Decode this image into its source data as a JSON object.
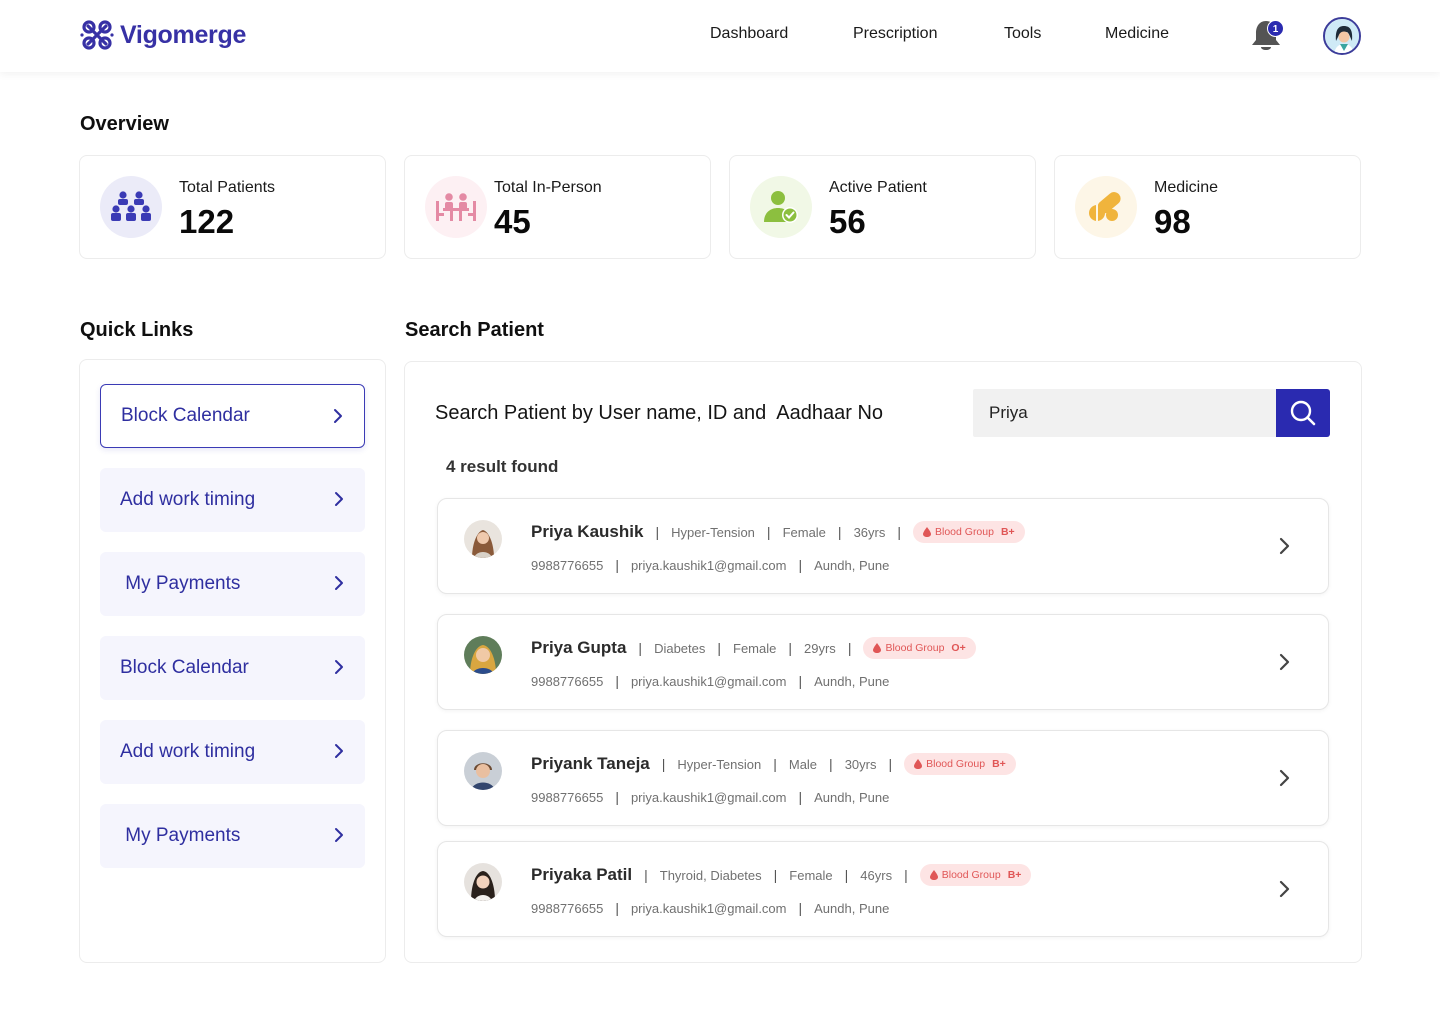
{
  "brand": {
    "name": "Vigomerge",
    "accent": "#2a2ab0"
  },
  "nav": {
    "items": [
      "Dashboard",
      "Prescription",
      "Tools",
      "Medicine"
    ],
    "notifications": "1"
  },
  "overview": {
    "title": "Overview",
    "cards": [
      {
        "label": "Total Patients",
        "value": "122",
        "icon": "patients-group-icon",
        "color": "#3b3bb5",
        "bg": "#ebebf8"
      },
      {
        "label": "Total In-Person",
        "value": "45",
        "icon": "consultation-table-icon",
        "color": "#e48aa4",
        "bg": "#fdf0f3"
      },
      {
        "label": "Active Patient",
        "value": "56",
        "icon": "active-user-icon",
        "color": "#8cbf3f",
        "bg": "#f1f8e6"
      },
      {
        "label": "Medicine",
        "value": "98",
        "icon": "pills-icon",
        "color": "#f0b43c",
        "bg": "#fdf6e7"
      }
    ]
  },
  "quick_links": {
    "title": "Quick Links",
    "items": [
      {
        "label": "Block Calendar",
        "active": true
      },
      {
        "label": "Add work timing",
        "active": false
      },
      {
        "label": " My Payments",
        "active": false
      },
      {
        "label": "Block Calendar",
        "active": false
      },
      {
        "label": "Add work timing",
        "active": false
      },
      {
        "label": " My Payments",
        "active": false
      }
    ]
  },
  "search": {
    "title": "Search Patient",
    "heading": "Search Patient by User name, ID and  Aadhaar No",
    "query": "Priya",
    "results_label": "4 result found"
  },
  "results": [
    {
      "name": "Priya Kaushik",
      "condition": "Hyper-Tension",
      "gender": "Female",
      "age": "36yrs",
      "blood_label": "Blood Group",
      "blood": "B+",
      "phone": "9988776655",
      "email": "priya.kaushik1@gmail.com",
      "location": "Aundh, Pune"
    },
    {
      "name": "Priya Gupta",
      "condition": "Diabetes",
      "gender": "Female",
      "age": "29yrs",
      "blood_label": "Blood Group",
      "blood": "O+",
      "phone": "9988776655",
      "email": "priya.kaushik1@gmail.com",
      "location": "Aundh, Pune"
    },
    {
      "name": "Priyank Taneja",
      "condition": "Hyper-Tension",
      "gender": "Male",
      "age": "30yrs",
      "blood_label": "Blood Group",
      "blood": "B+",
      "phone": "9988776655",
      "email": "priya.kaushik1@gmail.com",
      "location": "Aundh, Pune"
    },
    {
      "name": "Priyaka Patil",
      "condition": "Thyroid, Diabetes",
      "gender": "Female",
      "age": "46yrs",
      "blood_label": "Blood Group",
      "blood": "B+",
      "phone": "9988776655",
      "email": "priya.kaushik1@gmail.com",
      "location": "Aundh, Pune"
    }
  ]
}
